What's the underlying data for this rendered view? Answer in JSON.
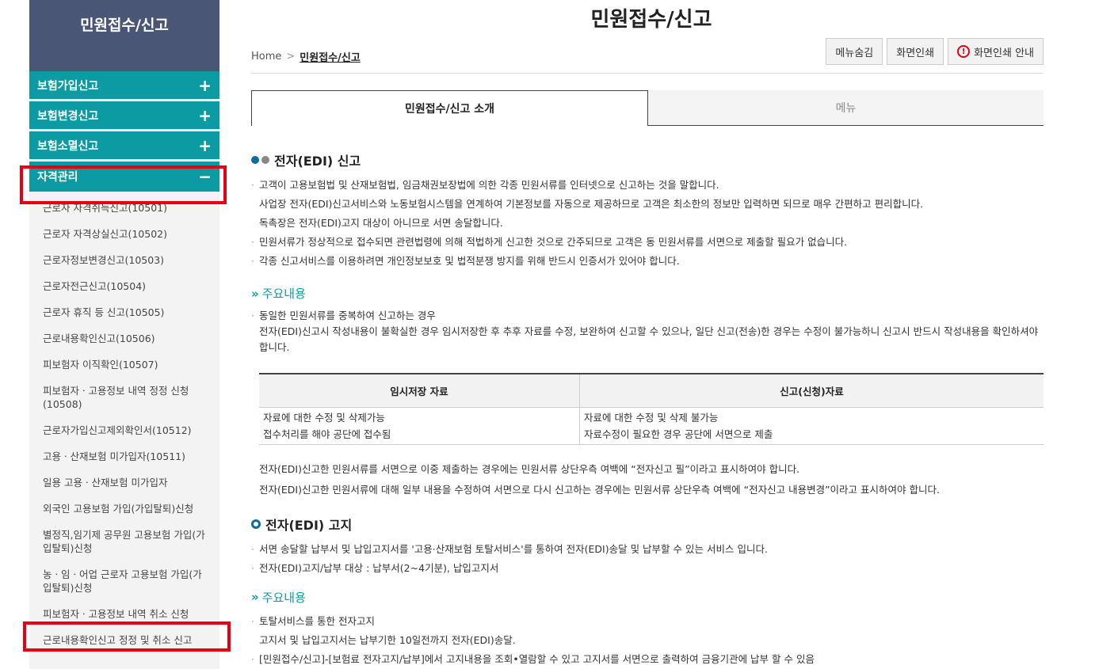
{
  "sidebar": {
    "title": "민원접수/신고",
    "categories": [
      {
        "label": "보험가입신고",
        "sign": "+"
      },
      {
        "label": "보험변경신고",
        "sign": "+"
      },
      {
        "label": "보험소멸신고",
        "sign": "+"
      },
      {
        "label": "자격관리",
        "sign": "−"
      }
    ],
    "sub_items": [
      "근로자 자격취득신고(10501)",
      "근로자 자격상실신고(10502)",
      "근로자정보변경신고(10503)",
      "근로자전근신고(10504)",
      "근로자 휴직 등 신고(10505)",
      "근로내용확인신고(10506)",
      "피보험자 이직확인(10507)",
      "피보험자ㆍ고용정보 내역 정정 신청(10508)",
      "근로자가입신고제외확인서(10512)",
      "고용ㆍ산재보험 미가입자(10511)",
      "일용 고용ㆍ산재보험 미가입자",
      "외국인 고용보험 가입(가입탈퇴)신청",
      "별정직,임기제 공무원 고용보험 가입(가입탈퇴)신청",
      "농ㆍ임ㆍ어업 근로자 고용보험 가입(가입탈퇴)신청",
      "피보험자ㆍ고용정보 내역 취소 신청",
      "근로내용확인신고 정정 및 취소 신고"
    ]
  },
  "header": {
    "title": "민원접수/신고",
    "breadcrumb": {
      "home": "Home",
      "sep": ">",
      "current": "민원접수/신고"
    },
    "buttons": {
      "hide_menu": "메뉴숨김",
      "print": "화면인쇄",
      "print_guide": "화면인쇄 안내"
    }
  },
  "tabs": [
    {
      "label": "민원접수/신고 소개",
      "active": true
    },
    {
      "label": "메뉴",
      "active": false
    }
  ],
  "edi_report": {
    "heading": "전자(EDI) 신고",
    "bullets": [
      {
        "text": "고객이 고용보험법 및 산재보험법, 임금채권보장법에 의한 각종 민원서류를 인터넷으로 신고하는 것을 말합니다.",
        "cont": false
      },
      {
        "text": "사업장 전자(EDI)신고서비스와 노동보험시스템을 연계하여 기본정보를 자동으로 제공하므로 고객은 최소한의 정보만 입력하면 되므로 매우 간편하고 편리합니다.",
        "cont": true
      },
      {
        "text": "독촉장은 전자(EDI)고지 대상이 아니므로 서면 송달합니다.",
        "cont": true
      },
      {
        "text": "민원서류가 정상적으로 접수되면 관련법령에 의해 적법하게 신고한 것으로 간주되므로 고객은 동 민원서류를 서면으로 제출할 필요가 없습니다.",
        "cont": false
      },
      {
        "text": "각종 신고서비스를 이용하려면 개인정보보호 및 법적분쟁 방지를 위해 반드시 인증서가 있어야 합니다.",
        "cont": false
      }
    ],
    "sub_heading": "주요내용",
    "sub_bullet": "동일한 민원서류를 중복하여 신고하는 경우",
    "sub_para": "전자(EDI)신고시 작성내용이 불확실한 경우 임시저장한 후 추후 자료를 수정, 보완하여 신고할 수 있으나, 일단 신고(전송)한 경우는 수정이 불가능하니 신고시 반드시 작성내용을 확인하셔야 합니다.",
    "table": {
      "headers": [
        "임시저장 자료",
        "신고(신청)자료"
      ],
      "rows": [
        [
          "자료에 대한 수정 및 삭제가능",
          "자료에 대한 수정 및 삭제 불가능"
        ],
        [
          "접수처리를 해야 공단에 접수됨",
          "자료수정이 필요한 경우 공단에 서면으로 제출"
        ]
      ]
    },
    "notes": [
      "전자(EDI)신고한 민원서류를 서면으로 이중 제출하는 경우에는 민원서류 상단우측 여백에 “전자신고 필”이라고 표시하여야 합니다.",
      "전자(EDI)신고한 민원서류에 대해 일부 내용을 수정하여 서면으로 다시 신고하는 경우에는 민원서류 상단우측 여백에 “전자신고 내용변경”이라고 표시하여야 합니다."
    ]
  },
  "edi_notice": {
    "heading": "전자(EDI) 고지",
    "bullets": [
      "서면 송달할 납부서 및 납입고지서를 '고용·산재보험 토탈서비스'를 통하여 전자(EDI)송달 및 납부할 수 있는 서비스 입니다.",
      "전자(EDI)고지/납부 대상 : 납부서(2~4기분), 납입고지서"
    ],
    "sub_heading": "주요내용",
    "sub_bullets": [
      {
        "text": "토탈서비스를 통한 전자고지",
        "cont": false
      },
      {
        "text": "고지서 및 납입고지서는 납부기한 10일전까지 전자(EDI)송달.",
        "cont": true
      },
      {
        "text": "[민원접수/신고]-[보험료 전자고지/납부]에서 고지내용을 조회•열람할 수 있고 고지서를 서면으로 출력하여 금융기관에 납부 할 수 있음",
        "cont": false
      }
    ]
  },
  "colors": {
    "sidebar_header": "#4a5676",
    "accent": "#0d9ba3",
    "highlight": "#e60012"
  }
}
